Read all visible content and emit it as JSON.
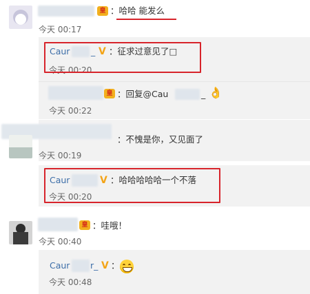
{
  "comments": [
    {
      "text": "：哈哈 能发么",
      "time": "今天 00:17"
    },
    {
      "name": "Caur",
      "name_suffix": "_",
      "text": "：征求过意见了□",
      "time": "今天 00:20"
    },
    {
      "reply_prefix": "：回复@Cau",
      "reply_suffix": "_",
      "time": "今天 00:22"
    },
    {
      "text": "：不愧是你，又见面了",
      "time": "今天 00:19"
    },
    {
      "name": "Caur",
      "text": "：哈哈哈哈哈一个不落",
      "time": "今天 00:20"
    },
    {
      "text": "：哇哦！",
      "time": "今天 00:40"
    },
    {
      "name": "Caur",
      "name_suffix": "r_",
      "text": "：",
      "time": "今天 00:48"
    }
  ],
  "badges": {
    "crown": "皇",
    "verified": "V"
  },
  "colors": {
    "highlight": "#d7232a",
    "name": "#3d6ea8",
    "reply_bg": "#f2f2f2"
  }
}
